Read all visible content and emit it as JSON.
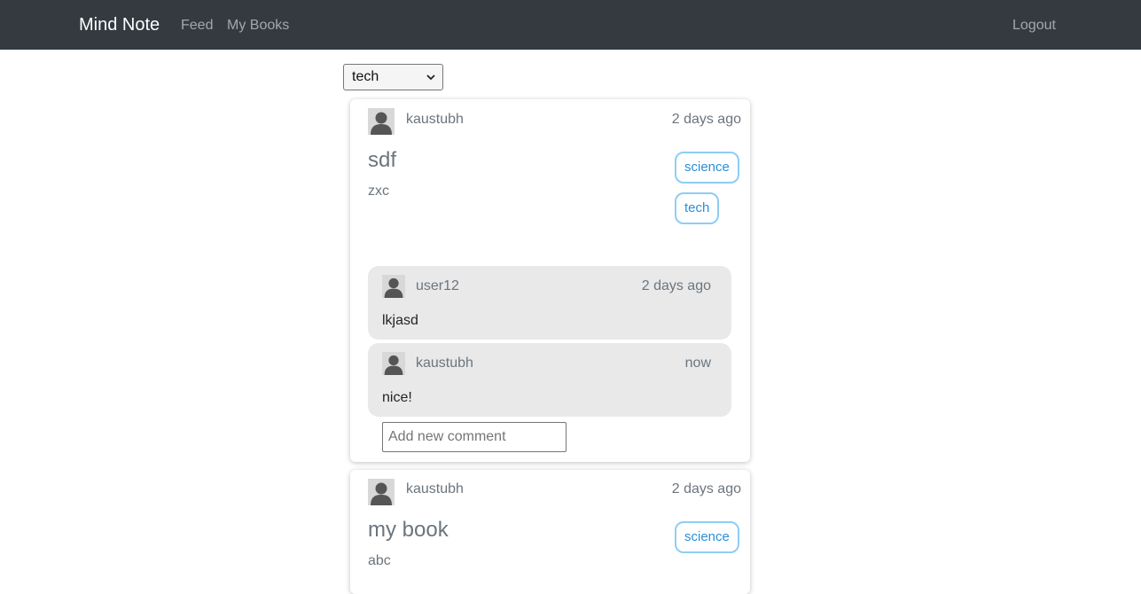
{
  "nav": {
    "brand": "Mind Note",
    "links": [
      "Feed",
      "My Books"
    ],
    "logout": "Logout"
  },
  "filter": {
    "selected": "tech"
  },
  "posts": [
    {
      "author": "kaustubh",
      "time": "2 days ago",
      "title": "sdf",
      "body": "zxc",
      "tags": [
        "science",
        "tech"
      ],
      "comments": [
        {
          "author": "user12",
          "time": "2 days ago",
          "text": "lkjasd"
        },
        {
          "author": "kaustubh",
          "time": "now",
          "text": "nice!"
        }
      ],
      "comment_placeholder": "Add new comment"
    },
    {
      "author": "kaustubh",
      "time": "2 days ago",
      "title": "my book",
      "body": "abc",
      "tags": [
        "science"
      ]
    }
  ],
  "colors": {
    "navbar": "#343a40",
    "tag_border": "#8ecdf3",
    "tag_text": "#2a8fd8",
    "comment_bg": "#e9e9e9"
  },
  "icons": {
    "avatar": "user-avatar-icon",
    "select_arrow": "chevron-down-icon"
  }
}
